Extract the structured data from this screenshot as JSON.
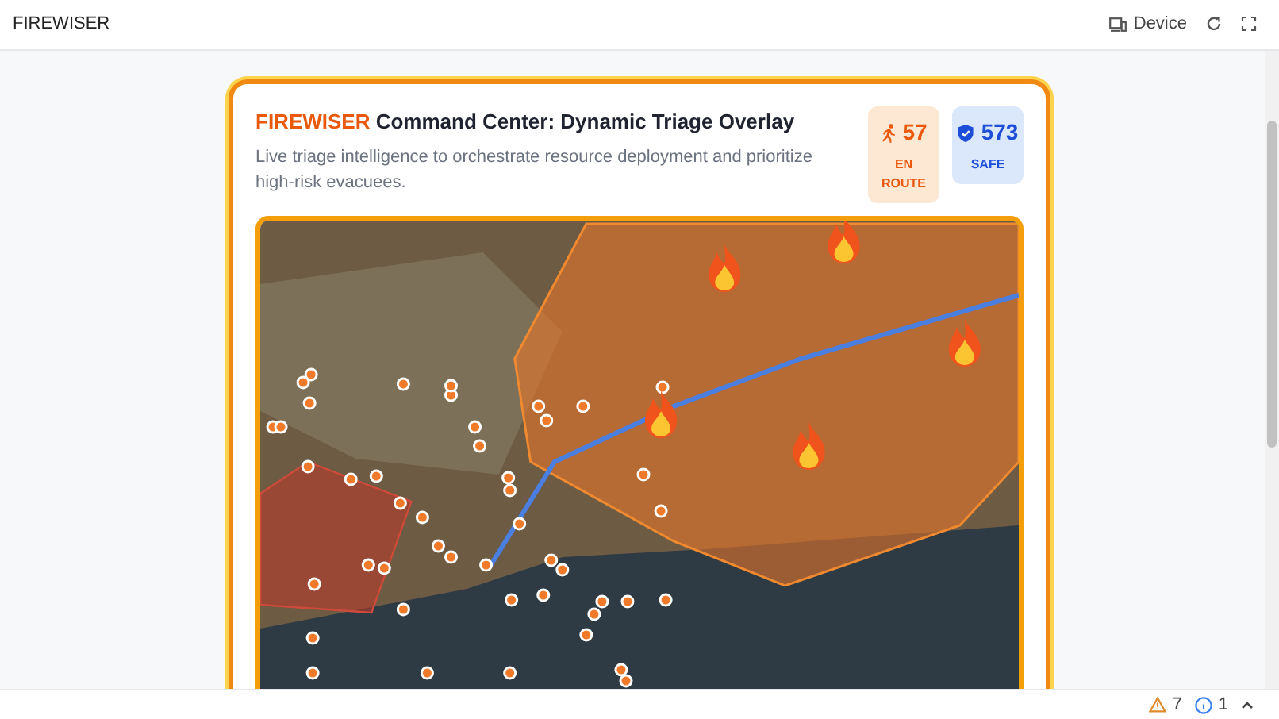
{
  "app_bar": {
    "title": "FIREWISER",
    "device_button": "Device"
  },
  "header": {
    "brand": "FIREWISER",
    "title": "Command Center: Dynamic Triage Overlay",
    "subtitle": "Live triage intelligence to orchestrate resource deployment and prioritize high-risk evacuees."
  },
  "stats": [
    {
      "kind": "en_route",
      "value": "57",
      "label": "EN ROUTE"
    },
    {
      "kind": "safe",
      "value": "573",
      "label": "SAFE"
    }
  ],
  "status_bar": {
    "warnings": "7",
    "info": "1"
  }
}
